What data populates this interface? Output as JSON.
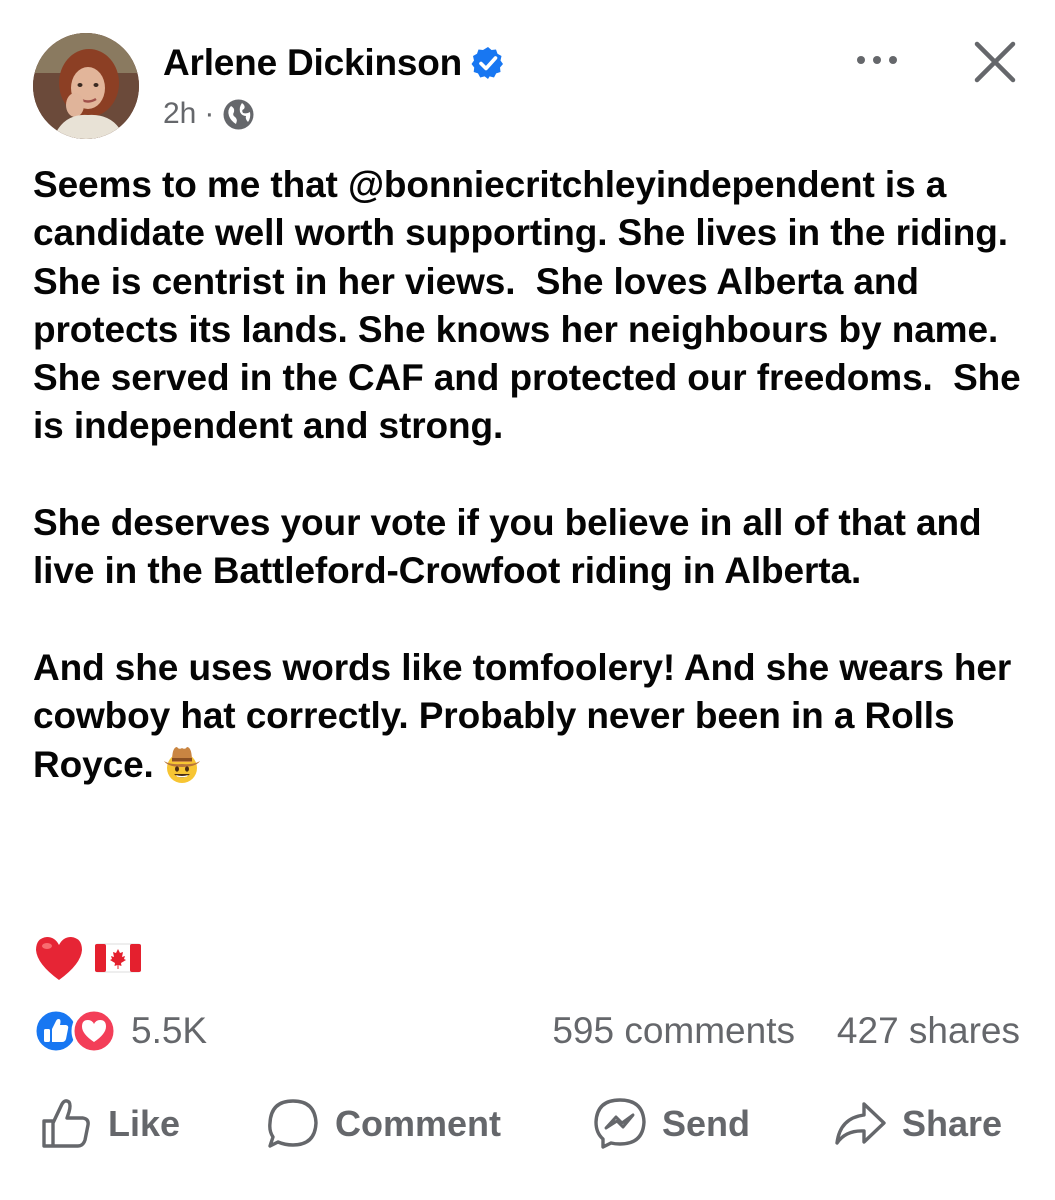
{
  "author": {
    "name": "Arlene Dickinson",
    "verified": true,
    "time": "2h",
    "separator": "·",
    "audience_icon": "globe-icon"
  },
  "header_actions": {
    "more_icon": "more-icon",
    "close_icon": "close-icon"
  },
  "post": {
    "paragraphs": [
      "Seems to me that @bonniecritchleyindependent is a candidate well worth supporting. She lives in the riding. She is centrist in her views.  She loves Alberta and protects its lands. She knows her neighbours by name. She served in the CAF and protected our freedoms.  She is independent and strong.",
      "She deserves your vote if you believe in all of that and live in the Battleford-Crowfoot riding in Alberta.",
      "And she uses words like tomfoolery! And she wears her cowboy hat correctly. Probably never been in a Rolls Royce."
    ],
    "trailing_emoji": "cowboy-hat-face",
    "reaction_emojis": [
      "heart",
      "canada-flag"
    ]
  },
  "stats": {
    "reactions": "5.5K",
    "comments": "595 comments",
    "shares": "427 shares",
    "reaction_types": [
      "like",
      "love"
    ]
  },
  "actions": {
    "like": "Like",
    "comment": "Comment",
    "send": "Send",
    "share": "Share"
  },
  "colors": {
    "verified_blue": "#1877f2",
    "like_blue": "#1877f2",
    "love_red": "#f33e58",
    "secondary_text": "#65676b"
  }
}
